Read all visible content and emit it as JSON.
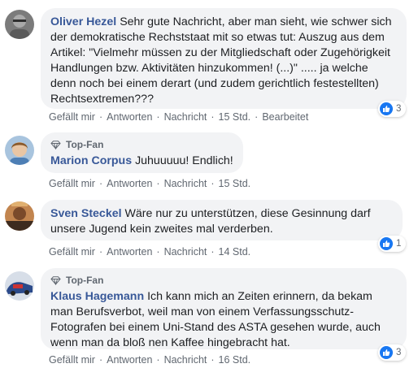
{
  "comments": [
    {
      "author": "Oliver Hezel",
      "text": "Sehr gute Nachricht, aber man sieht, wie schwer sich der demokratische Rechststaat mit so etwas tut: Auszug aus dem Artikel: \"Vielmehr müssen zu der Mitgliedschaft oder Zugehörigkeit Handlungen bzw. Aktivitäten hinzukommen! (...)\" ..... ja welche denn noch bei einem derart (und zudem gerichtlich festestellten) Rechtsextremen???",
      "actions": {
        "like": "Gefällt mir",
        "reply": "Antworten",
        "message": "Nachricht",
        "time": "15 Std.",
        "edited": "Bearbeitet"
      },
      "reaction_count": "3"
    },
    {
      "badge": "Top-Fan",
      "author": "Marion Corpus",
      "text": "Juhuuuuu! Endlich!",
      "actions": {
        "like": "Gefällt mir",
        "reply": "Antworten",
        "message": "Nachricht",
        "time": "15 Std."
      }
    },
    {
      "author": "Sven Steckel",
      "text": "Wäre nur zu unterstützen, diese Gesinnung darf unsere Jugend kein zweites mal verderben.",
      "actions": {
        "like": "Gefällt mir",
        "reply": "Antworten",
        "message": "Nachricht",
        "time": "14 Std."
      },
      "reaction_count": "1"
    },
    {
      "badge": "Top-Fan",
      "author": "Klaus Hagemann",
      "text": "Ich kann mich an Zeiten erinnern, da bekam man Berufsverbot, weil man von einem Verfassungsschutz-Fotografen bei einem Uni-Stand des ASTA gesehen wurde, auch wenn man da bloß nen Kaffee hingebracht hat.",
      "actions": {
        "like": "Gefällt mir",
        "reply": "Antworten",
        "message": "Nachricht",
        "time": "16 Std."
      },
      "reaction_count": "3"
    }
  ],
  "separator": "·",
  "colors": {
    "author": "#385898",
    "bubble": "#f2f3f5",
    "meta": "#606770",
    "like": "#1877f2"
  }
}
